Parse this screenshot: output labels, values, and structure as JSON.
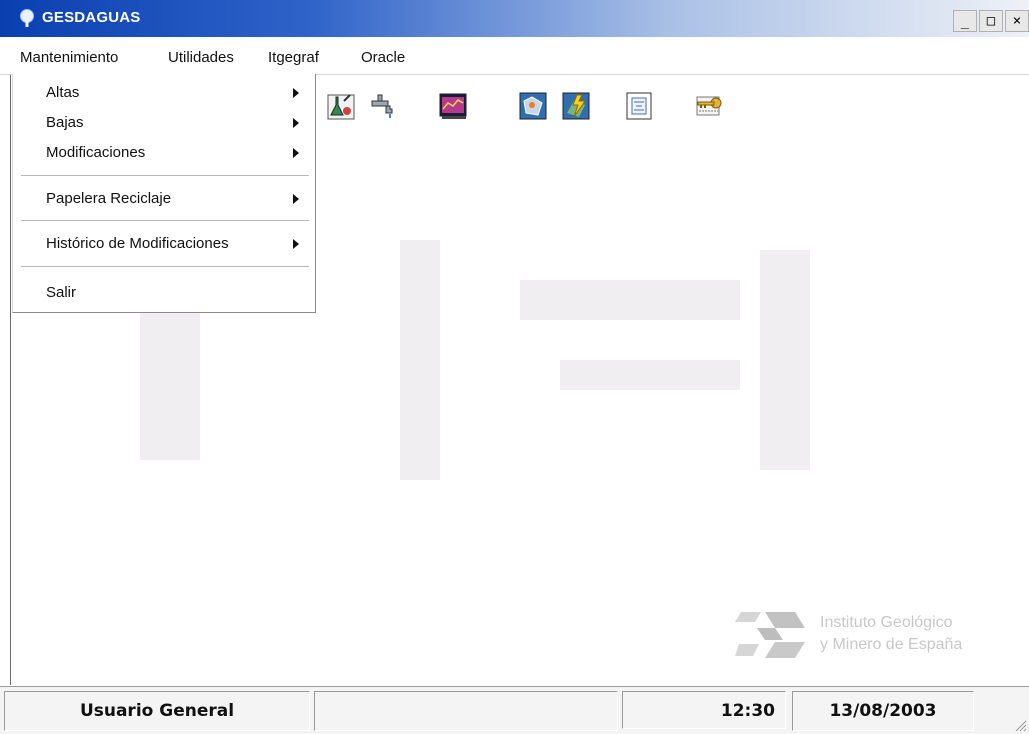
{
  "window": {
    "title": "GESDAGUAS",
    "controls": {
      "minimize": "_",
      "maximize": "□",
      "close": "×"
    }
  },
  "menubar": {
    "items": [
      "Mantenimiento",
      "Utilidades",
      "Itgegraf",
      "Oracle"
    ]
  },
  "dropdown": {
    "items": [
      {
        "label": "Altas",
        "submenu": true
      },
      {
        "label": "Bajas",
        "submenu": true
      },
      {
        "label": "Modificaciones",
        "submenu": true
      },
      {
        "label": "Papelera Reciclaje",
        "submenu": true
      },
      {
        "label": "Histórico de Modificaciones",
        "submenu": true
      },
      {
        "label": "Salir",
        "submenu": false
      }
    ]
  },
  "toolbar": {
    "icons": [
      "lab-flask-icon",
      "water-tap-icon",
      "chart-window-icon",
      "map-icon",
      "lightning-map-icon",
      "document-icon",
      "key-icon"
    ]
  },
  "brand": {
    "line1": "Instituto Geológico",
    "line2": "y Minero de España"
  },
  "statusbar": {
    "user": "Usuario General",
    "message": "",
    "time": "12:30",
    "date": "13/08/2003"
  },
  "colors": {
    "titlebar_start": "#0a3fb0",
    "titlebar_end": "#eef1f7",
    "menu_text": "#111111"
  }
}
